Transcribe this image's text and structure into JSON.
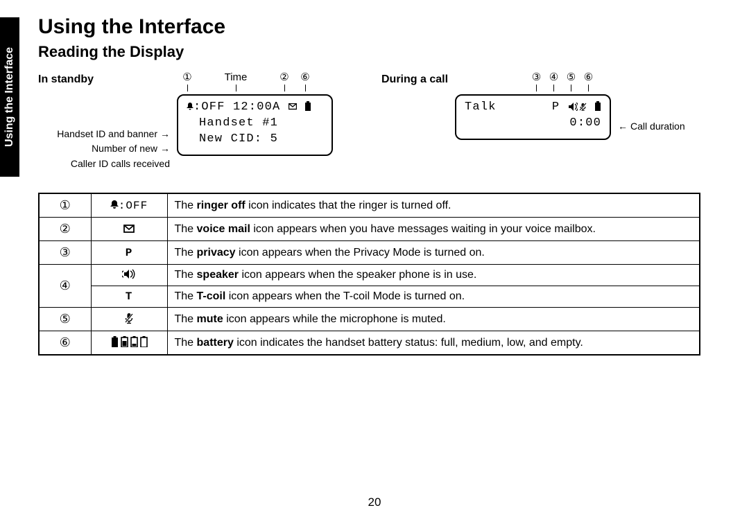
{
  "sideTab": "Using the Interface",
  "title": "Using the Interface",
  "subtitle": "Reading the Display",
  "standby": {
    "heading": "In standby",
    "labels": {
      "handsetBanner": "Handset ID and banner",
      "newCID1": "Number of new",
      "newCID2": "Caller ID calls received"
    },
    "callouts": {
      "one": "①",
      "time": "Time",
      "two": "②",
      "six": "⑥"
    },
    "lcd": {
      "line1_prefix": ":OFF 12:00A ",
      "line2": "Handset #1",
      "line3": "New CID: 5"
    }
  },
  "duringCall": {
    "heading": "During a call",
    "callouts": {
      "three": "③",
      "four": "④",
      "five": "⑤",
      "six": "⑥"
    },
    "lcd": {
      "line1_left": "Talk",
      "line1_right": "P ",
      "line2": "0:00"
    },
    "duration": "Call duration"
  },
  "tableRows": [
    {
      "num": "①",
      "iconType": "ringer-off",
      "desc_pre": "The ",
      "desc_bold": "ringer off",
      "desc_post": " icon indicates that the ringer is turned off."
    },
    {
      "num": "②",
      "iconType": "voicemail",
      "desc_pre": "The ",
      "desc_bold": "voice mail",
      "desc_post": " icon appears when you have messages waiting in your voice mailbox."
    },
    {
      "num": "③",
      "iconType": "privacy",
      "desc_pre": "The ",
      "desc_bold": "privacy",
      "desc_post": " icon appears when the Privacy Mode is turned on."
    },
    {
      "num": "④",
      "iconType": "speaker",
      "desc_pre": "The ",
      "desc_bold": "speaker",
      "desc_post": " icon appears when the speaker phone is in use."
    },
    {
      "num": "",
      "iconType": "tcoil",
      "desc_pre": "The ",
      "desc_bold": "T-coil",
      "desc_post": " icon appears when the T-coil Mode is turned on."
    },
    {
      "num": "⑤",
      "iconType": "mute",
      "desc_pre": "The ",
      "desc_bold": "mute",
      "desc_post": " icon appears while the microphone is muted."
    },
    {
      "num": "⑥",
      "iconType": "battery",
      "desc_pre": "The ",
      "desc_bold": "battery",
      "desc_post": " icon indicates the handset battery status: full, medium, low, and empty."
    }
  ],
  "pageNumber": "20"
}
